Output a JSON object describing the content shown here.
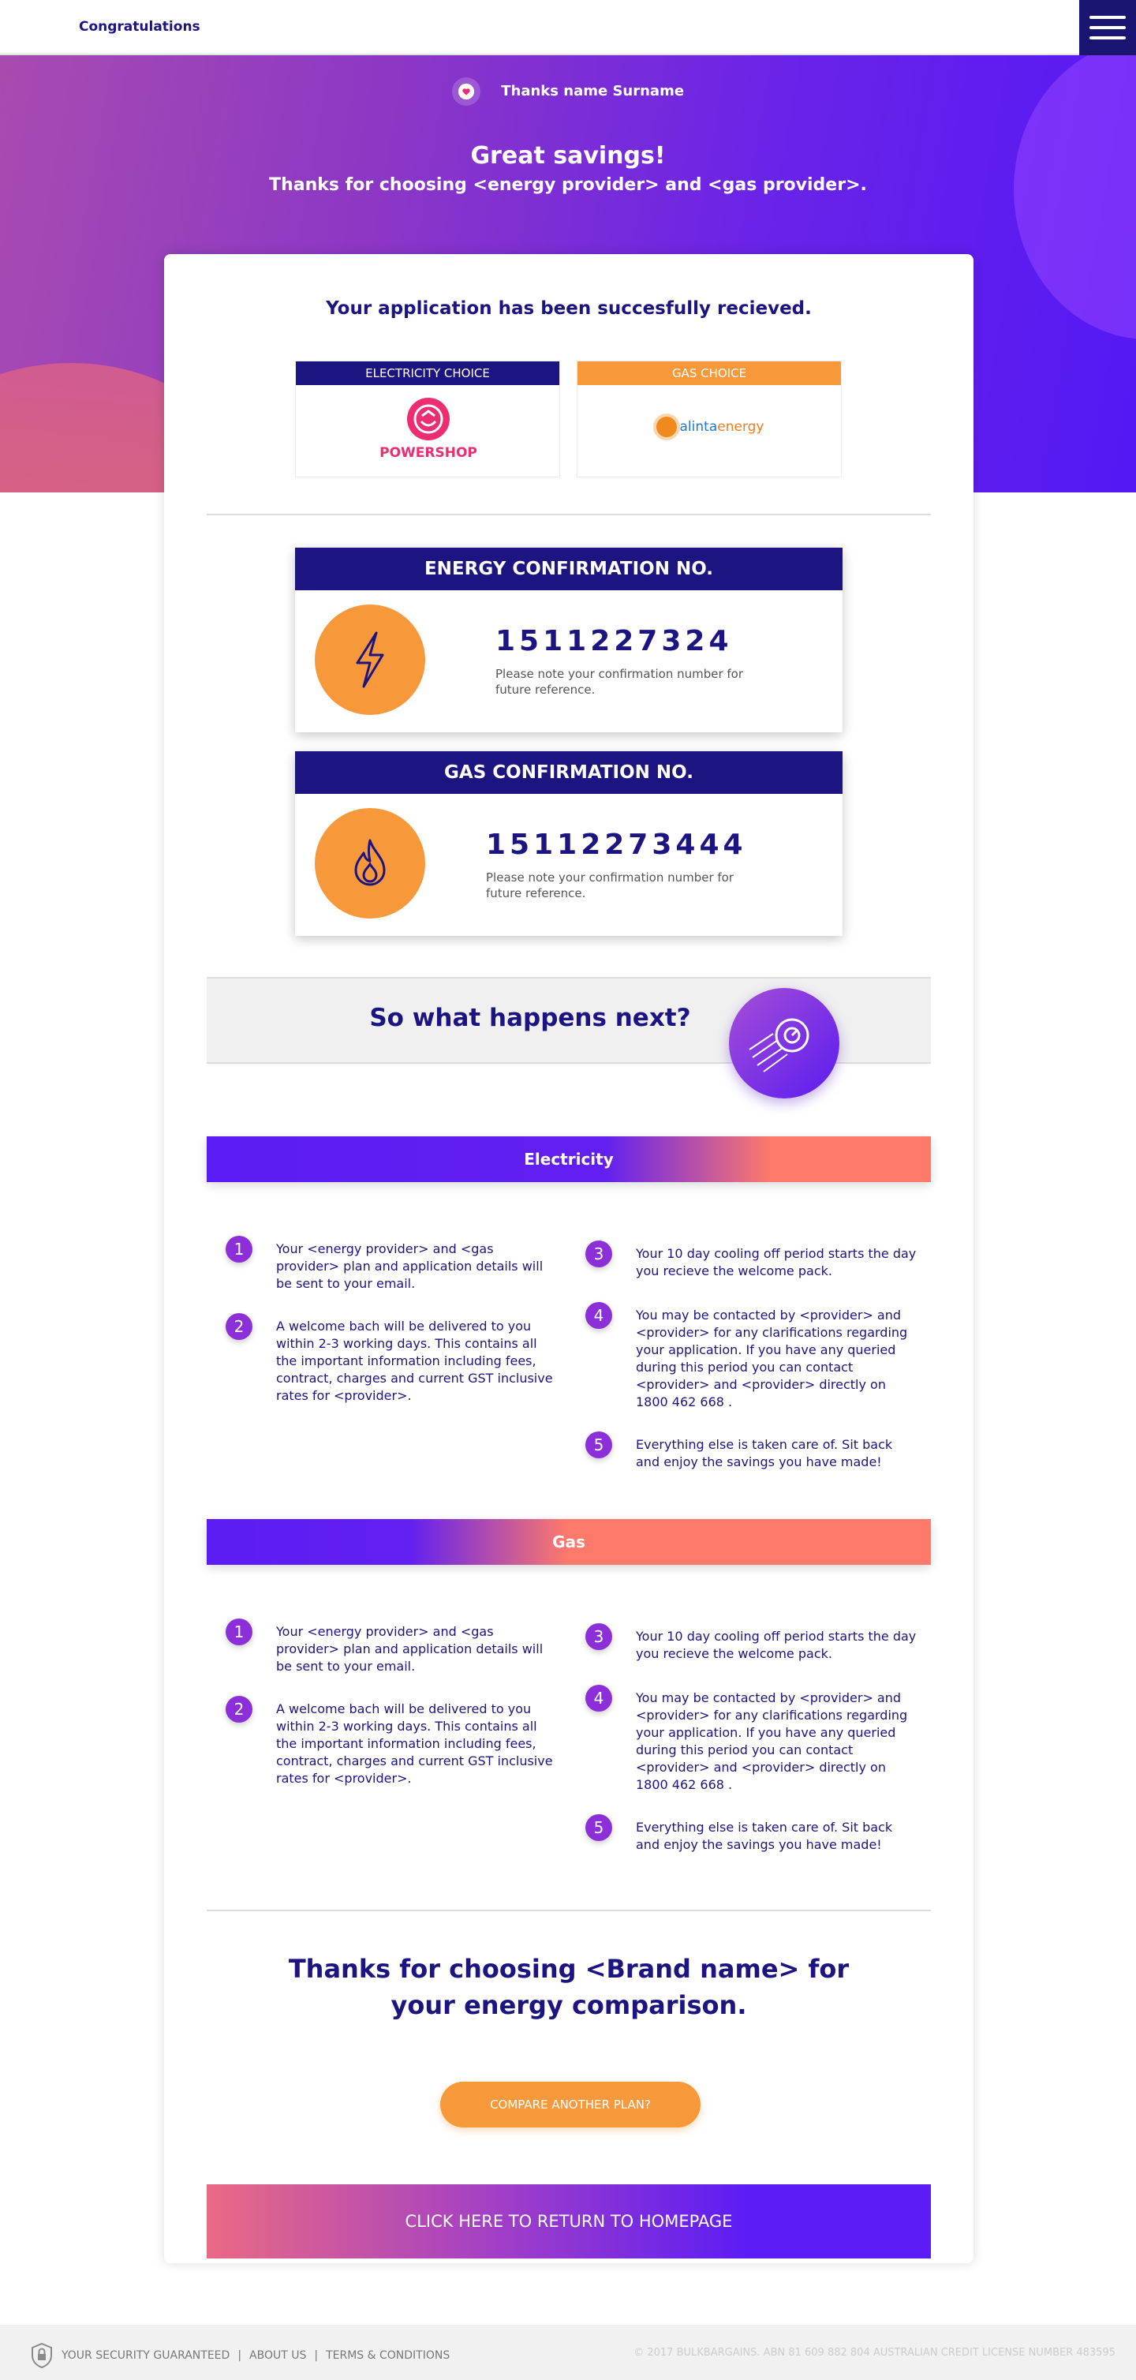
{
  "topbar": {
    "breadcrumb": "Congratulations",
    "menu_icon": "hamburger-icon"
  },
  "hero": {
    "user_name": "Thanks name Surname",
    "title": "Great savings!",
    "subtitle": "Thanks for choosing <energy provider> and <gas provider>."
  },
  "application": {
    "received": "Your application has been succesfully recieved.",
    "electricity_choice_label": "ELECTRICITY CHOICE",
    "electricity_provider": "POWERSHOP",
    "gas_choice_label": "GAS CHOICE",
    "gas_provider_part1": "alinta",
    "gas_provider_part2": "energy"
  },
  "energy_confirmation": {
    "title": "ENERGY CONFIRMATION NO.",
    "number": "1511227324",
    "note": "Please note your confirmation number for future reference."
  },
  "gas_confirmation": {
    "title": "GAS CONFIRMATION NO.",
    "number": "15112273444",
    "note": "Please note your confirmation number for future reference."
  },
  "next_steps": {
    "heading": "So what happens next?",
    "electricity": {
      "label": "Electricity",
      "steps": [
        "Your <energy provider> and <gas provider> plan and application details will be sent to your email.",
        "A welcome bach will be delivered to you within 2-3 working days. This contains all the important information including fees, contract, charges and current GST inclusive rates for <provider>.",
        "Your 10 day cooling off period starts the day you recieve the welcome pack.",
        "You may be contacted by <provider> and <provider> for any clarifications regarding your application. If you have any queried during this period you can contact <provider> and <provider> directly on 1800 462 668 .",
        "Everything else is taken care of. Sit back and enjoy the savings you have made!"
      ]
    },
    "gas": {
      "label": "Gas",
      "steps": [
        "Your <energy provider> and <gas provider> plan and application details will be sent to your email.",
        "A welcome bach will be delivered to you within 2-3 working days. This contains all the important information including fees, contract, charges and current GST inclusive rates for <provider>.",
        "Your 10 day cooling off period starts the day you recieve the welcome pack.",
        "You may be contacted by <provider> and <provider> for any clarifications regarding your application. If you have any queried during this period you can contact <provider> and <provider> directly on 1800 462 668 .",
        "Everything else is taken care of. Sit back and enjoy the savings you have made!"
      ]
    },
    "numbers": [
      "1",
      "2",
      "3",
      "4",
      "5"
    ]
  },
  "closing": {
    "thanks_line1": "Thanks for choosing <Brand name> for",
    "thanks_line2": "your energy comparison.",
    "compare_button": "COMPARE ANOTHER PLAN?",
    "home_button": "CLICK HERE TO RETURN TO HOMEPAGE"
  },
  "footer": {
    "security": "YOUR SECURITY GUARANTEED",
    "about": "ABOUT US",
    "terms": "TERMS & CONDITIONS",
    "sep": "|",
    "copyright": "© 2017 BULKBARGAINS. ABN 81 609 882 804 AUSTRALIAN CREDIT LICENSE NUMBER 483595"
  },
  "colors": {
    "navy": "#1c1480",
    "orange": "#f7983a",
    "purple": "#5b1cf5",
    "coral": "#ff7a6a",
    "powershop_pink": "#ee2c72"
  }
}
